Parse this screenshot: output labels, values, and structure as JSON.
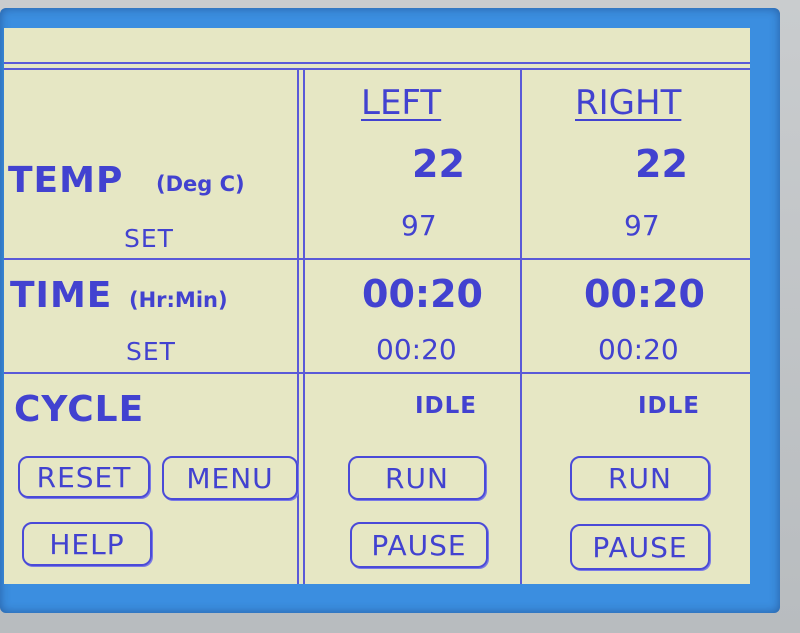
{
  "labels": {
    "temp": "TEMP",
    "temp_unit": "(Deg C)",
    "time": "TIME",
    "time_unit": "(Hr:Min)",
    "set": "SET",
    "cycle": "CYCLE"
  },
  "columns": {
    "left": {
      "header": "LEFT",
      "temp": "22",
      "temp_set": "97",
      "time": "00:20",
      "time_set": "00:20",
      "cycle_status": "IDLE",
      "run_label": "RUN",
      "pause_label": "PAUSE"
    },
    "right": {
      "header": "RIGHT",
      "temp": "22",
      "temp_set": "97",
      "time": "00:20",
      "time_set": "00:20",
      "cycle_status": "IDLE",
      "run_label": "RUN",
      "pause_label": "PAUSE"
    }
  },
  "buttons": {
    "reset": "RESET",
    "menu": "MENU",
    "help": "HELP"
  },
  "colors": {
    "screen_bg": "#e6e7c4",
    "text": "#4242d0",
    "lines": "#5a5ad8",
    "frame": "#3b8ee0"
  }
}
